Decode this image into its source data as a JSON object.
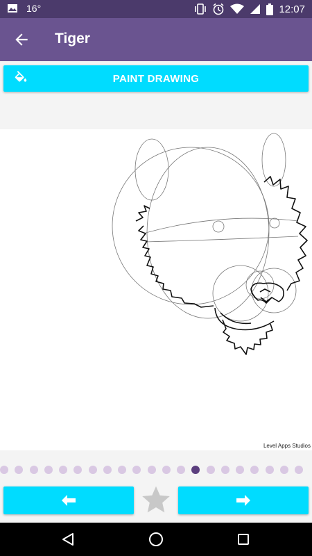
{
  "status_bar": {
    "temperature": "16°",
    "time": "12:07",
    "icons": [
      "image-icon",
      "vibrate-icon",
      "alarm-icon",
      "wifi-icon",
      "signal-icon",
      "battery-icon"
    ]
  },
  "app_bar": {
    "title": "Tiger",
    "back_icon": "arrow-left-icon"
  },
  "paint_button": {
    "label": "PAINT DRAWING",
    "icon": "paint-bucket-icon"
  },
  "canvas": {
    "credit": "Level Apps Studios"
  },
  "progress": {
    "total_steps": 21,
    "current_step": 14
  },
  "navigation": {
    "prev_icon": "arrow-left-icon",
    "favorite_icon": "star-icon",
    "next_icon": "arrow-right-icon"
  },
  "colors": {
    "status_bar": "#4b3a6b",
    "app_bar": "#6a5490",
    "accent": "#00dcff",
    "dot_inactive": "#d9c8e3",
    "dot_active": "#5b3e7e"
  }
}
